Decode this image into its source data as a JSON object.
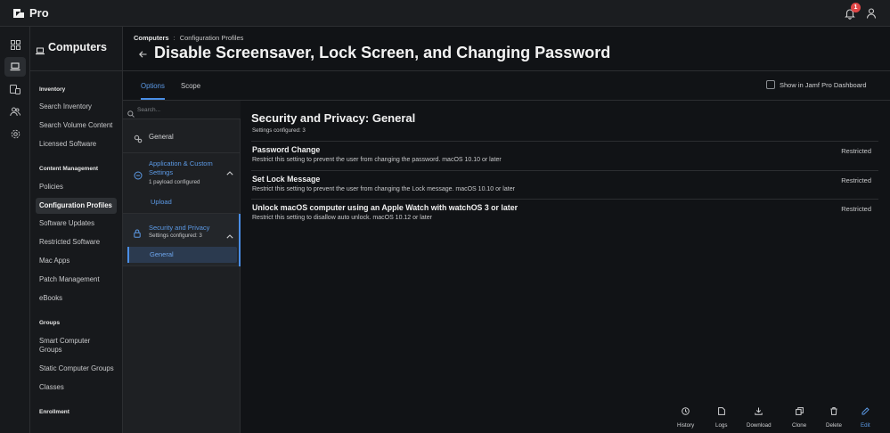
{
  "app": {
    "name": "Pro",
    "notification_count": "1"
  },
  "rail": {
    "items": [
      {
        "icon": "dashboard-icon"
      },
      {
        "icon": "computer-icon",
        "active": true
      },
      {
        "icon": "devices-icon"
      },
      {
        "icon": "users-icon"
      },
      {
        "icon": "settings-icon"
      }
    ]
  },
  "nav": {
    "title": "Computers",
    "sections": [
      {
        "heading": "Inventory",
        "links": [
          "Search Inventory",
          "Search Volume Content",
          "Licensed Software"
        ]
      },
      {
        "heading": "Content Management",
        "links": [
          "Policies",
          "Configuration Profiles",
          "Software Updates",
          "Restricted Software",
          "Mac Apps",
          "Patch Management",
          "eBooks"
        ]
      },
      {
        "heading": "Groups",
        "links": [
          "Smart Computer Groups",
          "Static Computer Groups",
          "Classes"
        ]
      },
      {
        "heading": "Enrollment",
        "links": []
      }
    ],
    "active_link": "Configuration Profiles"
  },
  "breadcrumb": {
    "parent": "Computers",
    "separator": ":",
    "current": "Configuration Profiles"
  },
  "page_title": "Disable Screensaver, Lock Screen, and Changing Password",
  "tabs": [
    {
      "label": "Options",
      "active": true
    },
    {
      "label": "Scope",
      "active": false
    }
  ],
  "dashboard_checkbox": {
    "label": "Show in Jamf Pro Dashboard",
    "checked": false
  },
  "payloads": {
    "search_placeholder": "Search...",
    "general": {
      "label": "General"
    },
    "app_custom": {
      "label": "Application & Custom Settings",
      "sub": "1 payload configured",
      "child": "Upload"
    },
    "security": {
      "label": "Security and Privacy",
      "sub": "Settings configured: 3",
      "child": "General"
    }
  },
  "detail": {
    "title": "Security and Privacy: General",
    "subtitle": "Settings configured: 3",
    "settings": [
      {
        "name": "Password Change",
        "description": "Restrict this setting to prevent the user from changing the password. macOS 10.10 or later",
        "status": "Restricted"
      },
      {
        "name": "Set Lock Message",
        "description": "Restrict this setting to prevent the user from changing the Lock message. macOS 10.10 or later",
        "status": "Restricted"
      },
      {
        "name": "Unlock macOS computer using an Apple Watch with watchOS 3 or later",
        "description": "Restrict this setting to disallow auto unlock. macOS 10.12 or later",
        "status": "Restricted"
      }
    ]
  },
  "actions": [
    {
      "label": "History",
      "icon": "history-icon"
    },
    {
      "label": "Logs",
      "icon": "logs-icon"
    },
    {
      "label": "Download",
      "icon": "download-icon"
    },
    {
      "label": "Clone",
      "icon": "clone-icon"
    },
    {
      "label": "Delete",
      "icon": "delete-icon"
    },
    {
      "label": "Edit",
      "icon": "edit-icon"
    }
  ],
  "colors": {
    "accent": "#4a8ee6",
    "badge": "#e04646",
    "background": "#111316"
  }
}
